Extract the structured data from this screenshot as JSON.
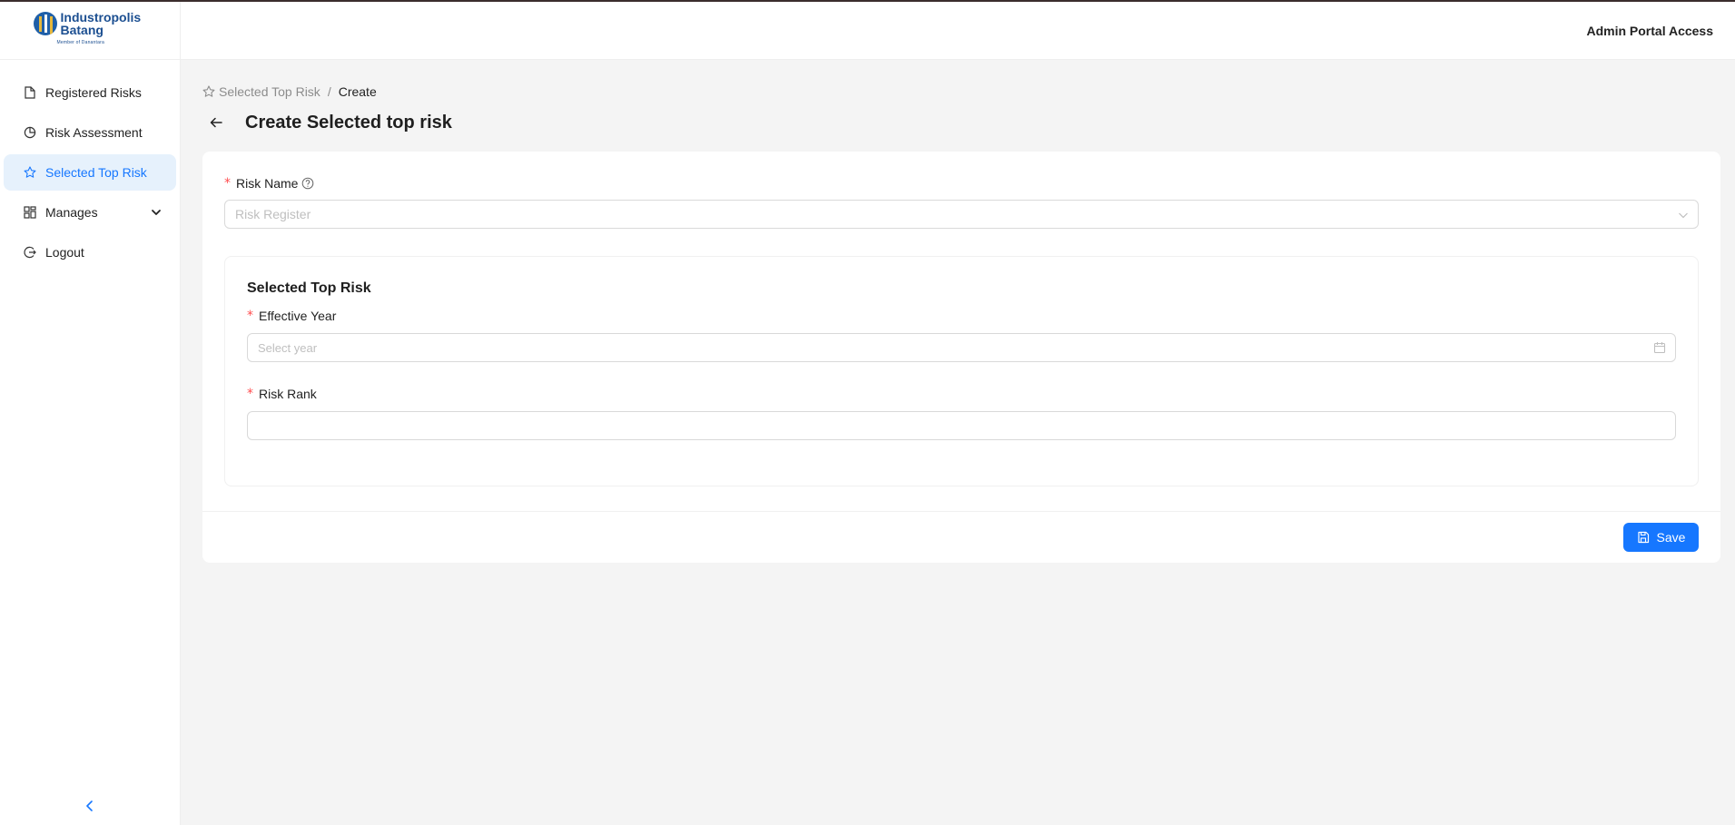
{
  "logo": {
    "name_line1": "Industropolis",
    "name_line2": "Batang",
    "tagline": "Member of Danantara"
  },
  "header": {
    "user_label": "Admin Portal Access"
  },
  "sidebar": {
    "items": [
      {
        "label": "Registered Risks",
        "icon": "file-icon"
      },
      {
        "label": "Risk Assessment",
        "icon": "pie-chart-icon"
      },
      {
        "label": "Selected Top Risk",
        "icon": "star-icon",
        "active": true
      },
      {
        "label": "Manages",
        "icon": "dashboard-icon"
      },
      {
        "label": "Logout",
        "icon": "logout-icon"
      }
    ]
  },
  "breadcrumb": {
    "parent": "Selected Top Risk",
    "separator": "/",
    "current": "Create"
  },
  "page": {
    "title": "Create Selected top risk"
  },
  "form": {
    "required_mark": "*",
    "risk_name": {
      "label": "Risk Name",
      "placeholder": "Risk Register"
    },
    "section_title": "Selected Top Risk",
    "effective_year": {
      "label": "Effective Year",
      "placeholder": "Select year"
    },
    "risk_rank": {
      "label": "Risk Rank",
      "value": ""
    },
    "save_label": "Save"
  },
  "colors": {
    "primary": "#1677ff",
    "active_bg": "#e6f1fc",
    "required": "#ff4d4f",
    "brand": "#1c4f91"
  }
}
